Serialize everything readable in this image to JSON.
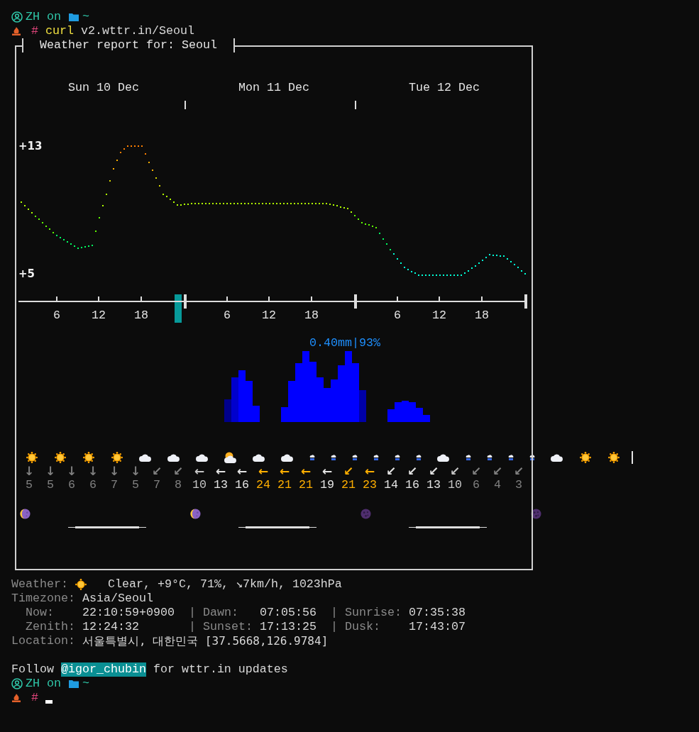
{
  "session_start": {
    "user": "ZH",
    "joiner": "on",
    "dir": "~",
    "symbol": "#",
    "program": "curl",
    "args": "v2.wttr.in/Seoul"
  },
  "report": {
    "title": "Weather report for: Seoul",
    "days": [
      "Sun 10 Dec",
      "Mon 11 Dec",
      "Tue 12 Dec"
    ],
    "temp_high": "+13",
    "temp_low": "+5",
    "hours": [
      "6",
      "12",
      "18",
      "6",
      "12",
      "18",
      "6",
      "12",
      "18"
    ],
    "precip_label": "0.40mm|93%",
    "conditions": [
      {
        "kind": "sun"
      },
      {
        "kind": "sun"
      },
      {
        "kind": "sun"
      },
      {
        "kind": "sun"
      },
      {
        "kind": "cloud"
      },
      {
        "kind": "cloud"
      },
      {
        "kind": "cloud"
      },
      {
        "kind": "partly"
      },
      {
        "kind": "cloud"
      },
      {
        "kind": "cloud"
      },
      {
        "kind": "rain"
      },
      {
        "kind": "rain"
      },
      {
        "kind": "rain"
      },
      {
        "kind": "rain"
      },
      {
        "kind": "rain"
      },
      {
        "kind": "rain"
      },
      {
        "kind": "cloud"
      },
      {
        "kind": "rain"
      },
      {
        "kind": "rain"
      },
      {
        "kind": "rain"
      },
      {
        "kind": "rain"
      },
      {
        "kind": "cloud"
      },
      {
        "kind": "sun"
      },
      {
        "kind": "sun"
      }
    ],
    "wind": [
      {
        "arrow": "↓",
        "speed": "5",
        "color": "#808080"
      },
      {
        "arrow": "↓",
        "speed": "5",
        "color": "#808080"
      },
      {
        "arrow": "↓",
        "speed": "6",
        "color": "#808080"
      },
      {
        "arrow": "↓",
        "speed": "6",
        "color": "#808080"
      },
      {
        "arrow": "↓",
        "speed": "7",
        "color": "#808080"
      },
      {
        "arrow": "↓",
        "speed": "5",
        "color": "#808080"
      },
      {
        "arrow": "↙",
        "speed": "7",
        "color": "#808080"
      },
      {
        "arrow": "↙",
        "speed": "8",
        "color": "#808080"
      },
      {
        "arrow": "←",
        "speed": "10",
        "color": "#c6c6c6"
      },
      {
        "arrow": "←",
        "speed": "13",
        "color": "#e4e4e4"
      },
      {
        "arrow": "←",
        "speed": "16",
        "color": "#e4e4e4"
      },
      {
        "arrow": "←",
        "speed": "24",
        "color": "#ffaf00"
      },
      {
        "arrow": "←",
        "speed": "21",
        "color": "#ffaf00"
      },
      {
        "arrow": "←",
        "speed": "21",
        "color": "#ffaf00"
      },
      {
        "arrow": "←",
        "speed": "19",
        "color": "#e4e4e4"
      },
      {
        "arrow": "↙",
        "speed": "21",
        "color": "#ffaf00"
      },
      {
        "arrow": "←",
        "speed": "23",
        "color": "#ffaf00"
      },
      {
        "arrow": "↙",
        "speed": "14",
        "color": "#e4e4e4"
      },
      {
        "arrow": "↙",
        "speed": "16",
        "color": "#e4e4e4"
      },
      {
        "arrow": "↙",
        "speed": "13",
        "color": "#e4e4e4"
      },
      {
        "arrow": "↙",
        "speed": "10",
        "color": "#c6c6c6"
      },
      {
        "arrow": "↙",
        "speed": "6",
        "color": "#808080"
      },
      {
        "arrow": "↙",
        "speed": "4",
        "color": "#808080"
      },
      {
        "arrow": "↙",
        "speed": "3",
        "color": "#808080"
      }
    ],
    "moons": [
      {
        "kind": "quarter"
      },
      {
        "kind": "quarter"
      },
      {
        "kind": "new"
      },
      {
        "kind": "new"
      }
    ]
  },
  "current": {
    "weather_label": "Weather:",
    "weather_value": "Clear, +9°C, 71%, ↘7km/h, 1023hPa",
    "timezone_label": "Timezone:",
    "timezone_value": "Asia/Seoul",
    "astro_rows": [
      [
        {
          "label": "Now:",
          "value": "22:10:59+0900"
        },
        {
          "separator": "|",
          "label": "Dawn:",
          "value": "07:05:56"
        },
        {
          "separator": "|",
          "label": "Sunrise:",
          "value": "07:35:38"
        }
      ],
      [
        {
          "label": "Zenith:",
          "value": "12:24:32"
        },
        {
          "separator": "|",
          "label": "Sunset:",
          "value": "17:13:25"
        },
        {
          "separator": "|",
          "label": "Dusk:",
          "value": "17:43:07"
        }
      ]
    ],
    "location_label": "Location:",
    "location_value": "서울특별시, 대한민국 [37.5668,126.9784]"
  },
  "follow": {
    "before": "Follow",
    "handle": "@igor_chubin",
    "after": "for wttr.in updates"
  },
  "session_end": {
    "user": "ZH",
    "joiner": "on",
    "dir": "~",
    "symbol": "#"
  }
}
